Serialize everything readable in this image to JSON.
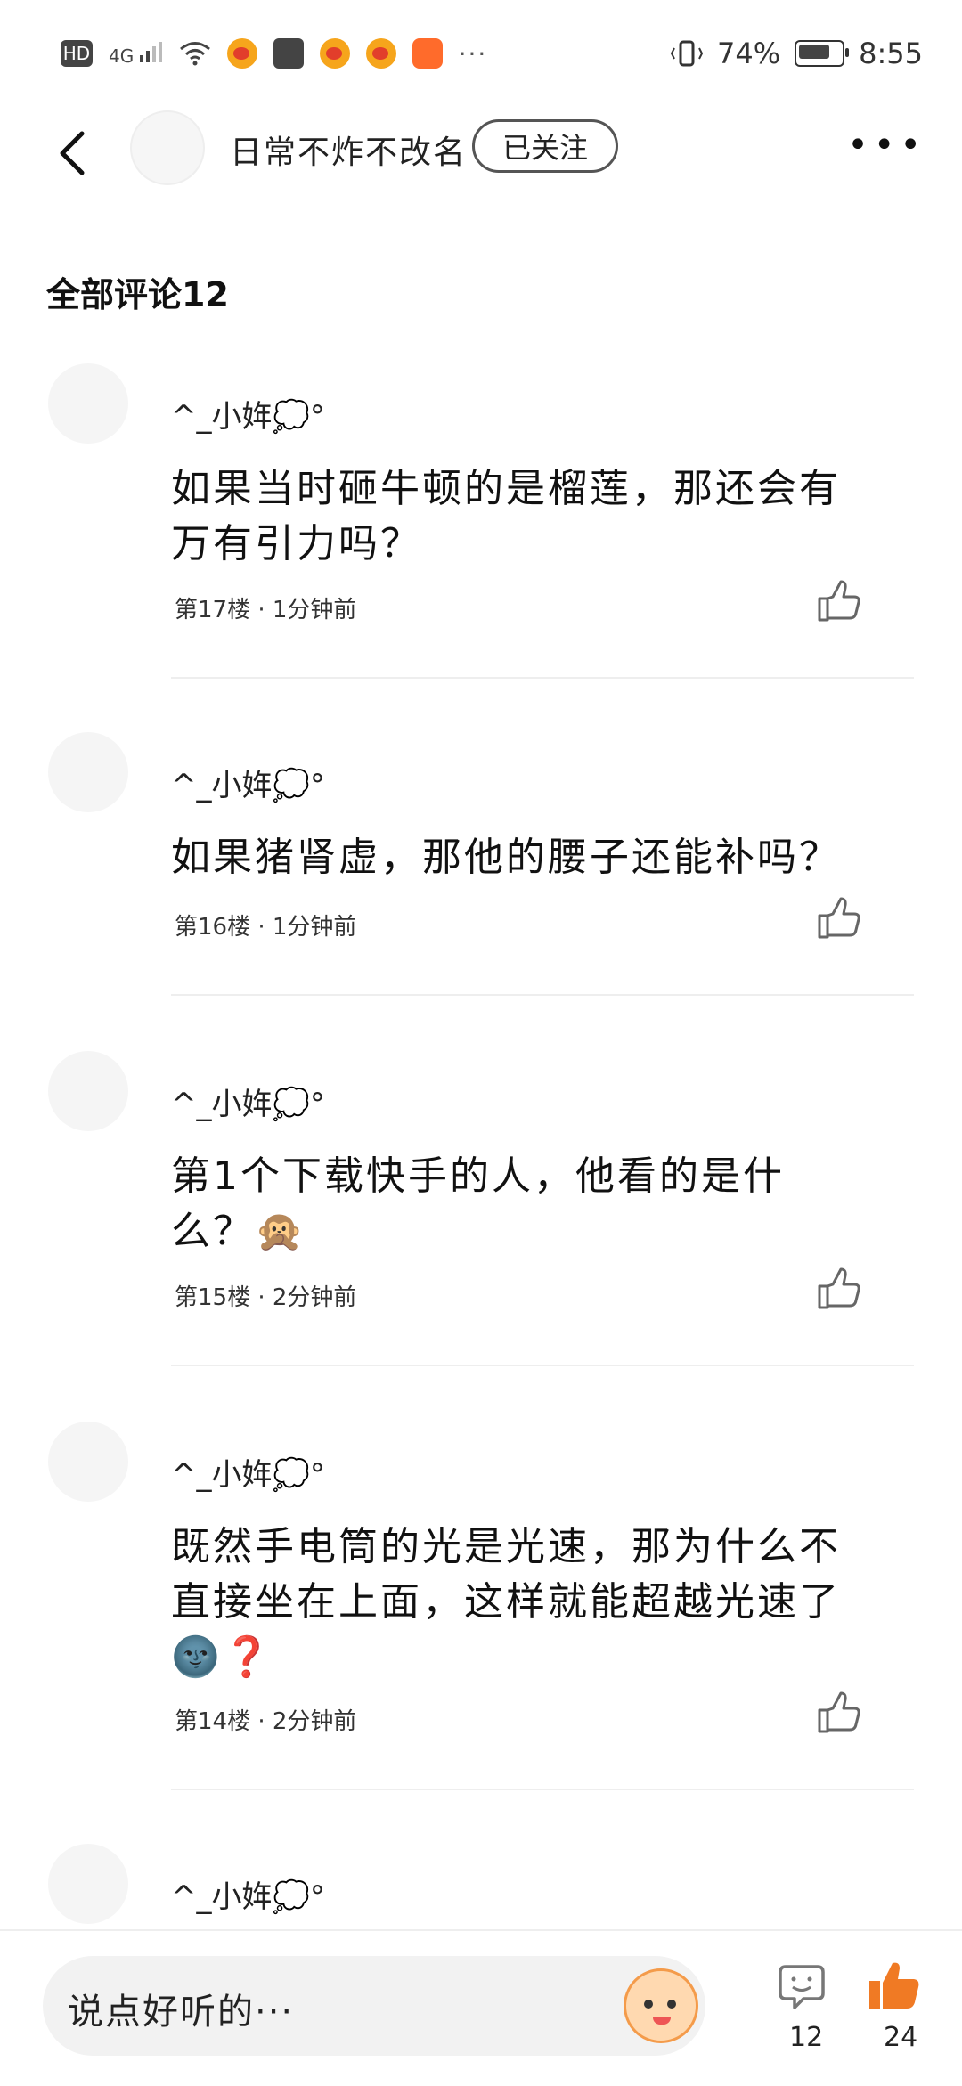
{
  "status_bar": {
    "hd": "HD",
    "network": "4G",
    "more": "···",
    "battery": "74%",
    "time": "8:55"
  },
  "header": {
    "author": "日常不炸不改名",
    "follow_label": "已关注",
    "more_label": "•••"
  },
  "comments_title": "全部评论12",
  "comments": [
    {
      "user": "^_小姩💭°",
      "text": "如果当时砸牛顿的是榴莲，那还会有万有引力吗？",
      "floor": "第17楼",
      "time": "1分钟前"
    },
    {
      "user": "^_小姩💭°",
      "text": "如果猪肾虚，那他的腰子还能补吗？",
      "floor": "第16楼",
      "time": "1分钟前"
    },
    {
      "user": "^_小姩💭°",
      "text": "第1个下载快手的人，他看的是什么？🙊",
      "floor": "第15楼",
      "time": "2分钟前"
    },
    {
      "user": "^_小姩💭°",
      "text": "既然手电筒的光是光速，那为什么不直接坐在上面，这样就能超越光速了🌚❓",
      "floor": "第14楼",
      "time": "2分钟前"
    },
    {
      "user": "^_小姩💭°"
    }
  ],
  "bottom_bar": {
    "placeholder": "说点好听的···",
    "comment_count": "12",
    "like_count": "24"
  },
  "colors": {
    "accent_like": "#f07a24",
    "follow_border": "#555555"
  }
}
